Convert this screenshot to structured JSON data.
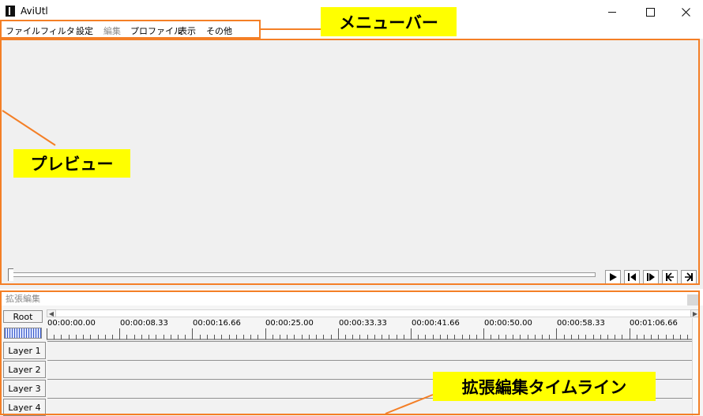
{
  "window": {
    "title": "AviUtl"
  },
  "menu": {
    "items": [
      {
        "label": "ファイル",
        "enabled": true
      },
      {
        "label": "フィルタ",
        "enabled": true
      },
      {
        "label": "設定",
        "enabled": true
      },
      {
        "label": "編集",
        "enabled": false
      },
      {
        "label": "プロファイル",
        "enabled": true
      },
      {
        "label": "表示",
        "enabled": true
      },
      {
        "label": "その他",
        "enabled": true
      }
    ]
  },
  "preview": {
    "seek_position": 0
  },
  "playback_controls": [
    {
      "name": "play-button",
      "icon": "play-icon"
    },
    {
      "name": "prev-frame-button",
      "icon": "prev-frame-icon"
    },
    {
      "name": "next-frame-button",
      "icon": "next-frame-icon"
    },
    {
      "name": "go-start-button",
      "icon": "go-start-icon"
    },
    {
      "name": "go-end-button",
      "icon": "go-end-icon"
    }
  ],
  "timeline": {
    "title": "拡張編集",
    "root_label": "Root",
    "ruler_labels": [
      "00:00:00.00",
      "00:00:08.33",
      "00:00:16.66",
      "00:00:25.00",
      "00:00:33.33",
      "00:00:41.66",
      "00:00:50.00",
      "00:00:58.33",
      "00:01:06.66"
    ],
    "layers": [
      "Layer 1",
      "Layer 2",
      "Layer 3",
      "Layer 4"
    ]
  },
  "annotations": {
    "menubar": "メニューバー",
    "preview": "プレビュー",
    "timeline": "拡張編集タイムライン"
  },
  "colors": {
    "annotation_border": "#f47f26",
    "annotation_label_bg": "#ffff00",
    "preview_bg": "#f0f0f0",
    "zoom_bar": "#3658c8"
  }
}
